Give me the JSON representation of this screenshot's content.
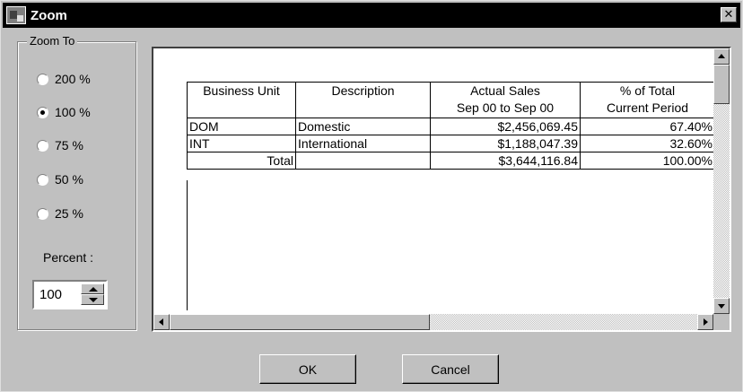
{
  "window": {
    "title": "Zoom",
    "close_glyph": "✕"
  },
  "zoom_group": {
    "legend": "Zoom To",
    "options": [
      {
        "label": "200 %",
        "checked": false
      },
      {
        "label": "100 %",
        "checked": true
      },
      {
        "label": "75 %",
        "checked": false
      },
      {
        "label": "50 %",
        "checked": false
      },
      {
        "label": "25 %",
        "checked": false
      }
    ],
    "percent_label": "Percent :",
    "percent_value": "100"
  },
  "report": {
    "headers": [
      [
        "Business Unit",
        ""
      ],
      [
        "Description",
        ""
      ],
      [
        "Actual Sales",
        "Sep 00 to Sep 00"
      ],
      [
        "% of Total",
        "Current Period"
      ]
    ],
    "rows": [
      {
        "unit": "DOM",
        "description": "Domestic",
        "sales": "$2,456,069.45",
        "pct": "67.40%"
      },
      {
        "unit": "INT",
        "description": "International",
        "sales": "$1,188,047.39",
        "pct": "32.60%"
      },
      {
        "unit": "Total",
        "description": "",
        "sales": "$3,644,116.84",
        "pct": "100.00%"
      }
    ]
  },
  "buttons": {
    "ok": "OK",
    "cancel": "Cancel"
  },
  "icons": {
    "app": "zoom-app-icon",
    "close": "close-icon",
    "spin_up": "spin-up-arrow-icon",
    "spin_down": "spin-down-arrow-icon",
    "scroll_up": "scroll-up-arrow-icon",
    "scroll_down": "scroll-down-arrow-icon",
    "scroll_left": "scroll-left-arrow-icon",
    "scroll_right": "scroll-right-arrow-icon"
  }
}
